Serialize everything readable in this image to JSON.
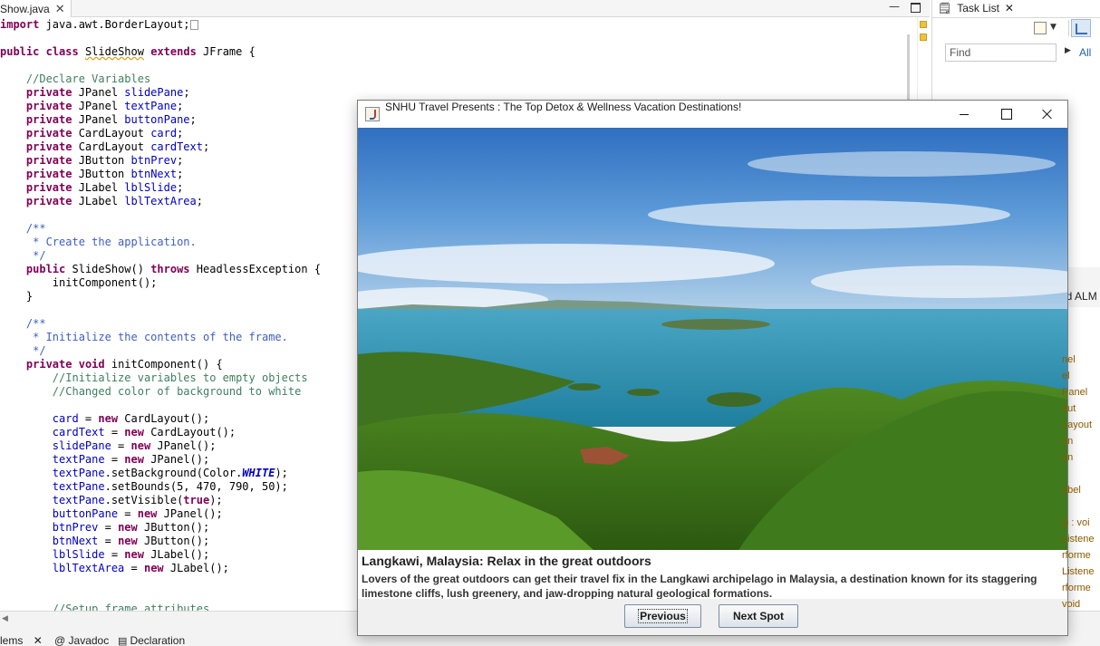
{
  "editor": {
    "tab_label": "Show.java",
    "minimize_glyph": "▭",
    "code_lines": [
      {
        "parts": [
          {
            "t": "import",
            "c": "kw"
          },
          {
            "t": " java.awt.BorderLayout;"
          }
        ]
      },
      {
        "parts": []
      },
      {
        "parts": [
          {
            "t": "public",
            "c": "kw"
          },
          {
            "t": " "
          },
          {
            "t": "class",
            "c": "kw"
          },
          {
            "t": " "
          },
          {
            "t": "SlideShow",
            "c": "ul"
          },
          {
            "t": " "
          },
          {
            "t": "extends",
            "c": "kw"
          },
          {
            "t": " JFrame {"
          }
        ]
      },
      {
        "parts": []
      },
      {
        "parts": [
          {
            "t": "    //Declare Variables",
            "c": "cmt"
          }
        ]
      },
      {
        "parts": [
          {
            "t": "    "
          },
          {
            "t": "private",
            "c": "kw"
          },
          {
            "t": " JPanel "
          },
          {
            "t": "slidePane",
            "c": "fld"
          },
          {
            "t": ";"
          }
        ]
      },
      {
        "parts": [
          {
            "t": "    "
          },
          {
            "t": "private",
            "c": "kw"
          },
          {
            "t": " JPanel "
          },
          {
            "t": "textPane",
            "c": "fld"
          },
          {
            "t": ";"
          }
        ]
      },
      {
        "parts": [
          {
            "t": "    "
          },
          {
            "t": "private",
            "c": "kw"
          },
          {
            "t": " JPanel "
          },
          {
            "t": "buttonPane",
            "c": "fld"
          },
          {
            "t": ";"
          }
        ]
      },
      {
        "parts": [
          {
            "t": "    "
          },
          {
            "t": "private",
            "c": "kw"
          },
          {
            "t": " CardLayout "
          },
          {
            "t": "card",
            "c": "fld"
          },
          {
            "t": ";"
          }
        ]
      },
      {
        "parts": [
          {
            "t": "    "
          },
          {
            "t": "private",
            "c": "kw"
          },
          {
            "t": " CardLayout "
          },
          {
            "t": "cardText",
            "c": "fld"
          },
          {
            "t": ";"
          }
        ]
      },
      {
        "parts": [
          {
            "t": "    "
          },
          {
            "t": "private",
            "c": "kw"
          },
          {
            "t": " JButton "
          },
          {
            "t": "btnPrev",
            "c": "fld"
          },
          {
            "t": ";"
          }
        ]
      },
      {
        "parts": [
          {
            "t": "    "
          },
          {
            "t": "private",
            "c": "kw"
          },
          {
            "t": " JButton "
          },
          {
            "t": "btnNext",
            "c": "fld"
          },
          {
            "t": ";"
          }
        ]
      },
      {
        "parts": [
          {
            "t": "    "
          },
          {
            "t": "private",
            "c": "kw"
          },
          {
            "t": " JLabel "
          },
          {
            "t": "lblSlide",
            "c": "fld"
          },
          {
            "t": ";"
          }
        ]
      },
      {
        "parts": [
          {
            "t": "    "
          },
          {
            "t": "private",
            "c": "kw"
          },
          {
            "t": " JLabel "
          },
          {
            "t": "lblTextArea",
            "c": "fld"
          },
          {
            "t": ";"
          }
        ]
      },
      {
        "parts": []
      },
      {
        "parts": [
          {
            "t": "    /**",
            "c": "jdoc"
          }
        ]
      },
      {
        "parts": [
          {
            "t": "     * Create the application.",
            "c": "jdoc"
          }
        ]
      },
      {
        "parts": [
          {
            "t": "     */",
            "c": "jdoc"
          }
        ]
      },
      {
        "parts": [
          {
            "t": "    "
          },
          {
            "t": "public",
            "c": "kw"
          },
          {
            "t": " SlideShow() "
          },
          {
            "t": "throws",
            "c": "kw"
          },
          {
            "t": " HeadlessException {"
          }
        ]
      },
      {
        "parts": [
          {
            "t": "        initComponent();"
          }
        ]
      },
      {
        "parts": [
          {
            "t": "    }"
          }
        ]
      },
      {
        "parts": []
      },
      {
        "parts": [
          {
            "t": "    /**",
            "c": "jdoc"
          }
        ]
      },
      {
        "parts": [
          {
            "t": "     * Initialize the contents of the frame.",
            "c": "jdoc"
          }
        ]
      },
      {
        "parts": [
          {
            "t": "     */",
            "c": "jdoc"
          }
        ]
      },
      {
        "parts": [
          {
            "t": "    "
          },
          {
            "t": "private",
            "c": "kw"
          },
          {
            "t": " "
          },
          {
            "t": "void",
            "c": "kw"
          },
          {
            "t": " initComponent() {"
          }
        ]
      },
      {
        "parts": [
          {
            "t": "        //Initialize variables to empty objects",
            "c": "cmt"
          }
        ]
      },
      {
        "parts": [
          {
            "t": "        //Changed color of background to white",
            "c": "cmt"
          }
        ]
      },
      {
        "parts": []
      },
      {
        "parts": [
          {
            "t": "        "
          },
          {
            "t": "card",
            "c": "fld"
          },
          {
            "t": " = "
          },
          {
            "t": "new",
            "c": "kw"
          },
          {
            "t": " CardLayout();"
          }
        ]
      },
      {
        "parts": [
          {
            "t": "        "
          },
          {
            "t": "cardText",
            "c": "fld"
          },
          {
            "t": " = "
          },
          {
            "t": "new",
            "c": "kw"
          },
          {
            "t": " CardLayout();"
          }
        ]
      },
      {
        "parts": [
          {
            "t": "        "
          },
          {
            "t": "slidePane",
            "c": "fld"
          },
          {
            "t": " = "
          },
          {
            "t": "new",
            "c": "kw"
          },
          {
            "t": " JPanel();"
          }
        ]
      },
      {
        "parts": [
          {
            "t": "        "
          },
          {
            "t": "textPane",
            "c": "fld"
          },
          {
            "t": " = "
          },
          {
            "t": "new",
            "c": "kw"
          },
          {
            "t": " JPanel();"
          }
        ]
      },
      {
        "parts": [
          {
            "t": "        "
          },
          {
            "t": "textPane",
            "c": "fld"
          },
          {
            "t": ".setBackground(Color."
          },
          {
            "t": "WHITE",
            "c": "cst"
          },
          {
            "t": ");"
          }
        ]
      },
      {
        "parts": [
          {
            "t": "        "
          },
          {
            "t": "textPane",
            "c": "fld"
          },
          {
            "t": ".setBounds(5, 470, 790, 50);"
          }
        ]
      },
      {
        "parts": [
          {
            "t": "        "
          },
          {
            "t": "textPane",
            "c": "fld"
          },
          {
            "t": ".setVisible("
          },
          {
            "t": "true",
            "c": "kw"
          },
          {
            "t": ");"
          }
        ]
      },
      {
        "parts": [
          {
            "t": "        "
          },
          {
            "t": "buttonPane",
            "c": "fld"
          },
          {
            "t": " = "
          },
          {
            "t": "new",
            "c": "kw"
          },
          {
            "t": " JPanel();"
          }
        ]
      },
      {
        "parts": [
          {
            "t": "        "
          },
          {
            "t": "btnPrev",
            "c": "fld"
          },
          {
            "t": " = "
          },
          {
            "t": "new",
            "c": "kw"
          },
          {
            "t": " JButton();"
          }
        ]
      },
      {
        "parts": [
          {
            "t": "        "
          },
          {
            "t": "btnNext",
            "c": "fld"
          },
          {
            "t": " = "
          },
          {
            "t": "new",
            "c": "kw"
          },
          {
            "t": " JButton();"
          }
        ]
      },
      {
        "parts": [
          {
            "t": "        "
          },
          {
            "t": "lblSlide",
            "c": "fld"
          },
          {
            "t": " = "
          },
          {
            "t": "new",
            "c": "kw"
          },
          {
            "t": " JLabel();"
          }
        ]
      },
      {
        "parts": [
          {
            "t": "        "
          },
          {
            "t": "lblTextArea",
            "c": "fld"
          },
          {
            "t": " = "
          },
          {
            "t": "new",
            "c": "kw"
          },
          {
            "t": " JLabel();"
          }
        ]
      },
      {
        "parts": []
      },
      {
        "parts": []
      },
      {
        "parts": [
          {
            "t": "        //Setup frame attributes",
            "c": "cmt"
          }
        ]
      }
    ]
  },
  "right_view": {
    "tab_label": "Task List",
    "find_placeholder": "Find",
    "all_label": "All",
    "outline_title": "nd ALM",
    "outline_items": [
      "nel",
      "el",
      "Panel",
      "out",
      "Layout",
      "on",
      "on",
      "",
      "abel",
      "",
      "() : voi",
      "Listene",
      "rforme",
      "Listene",
      "rforme",
      "void"
    ]
  },
  "bottom_tabs": [
    {
      "label": "lems"
    },
    {
      "label": "@ Javadoc"
    },
    {
      "label": "Declaration"
    }
  ],
  "slideshow": {
    "title": "SNHU Travel Presents : The Top Detox & Wellness Vacation Destinations!",
    "slide_heading": "Langkawi, Malaysia: Relax in the great outdoors",
    "slide_description": "Lovers of the great outdoors can get their travel fix in the Langkawi archipelago in Malaysia, a destination known for its staggering limestone cliffs, lush greenery, and jaw-dropping natural geological formations.",
    "prev_label": "Previous",
    "next_label": "Next Spot"
  },
  "colors": {
    "keyword": "#7f0055",
    "field": "#0000c0",
    "comment": "#3f7f5f",
    "javadoc": "#3f5fbf"
  }
}
